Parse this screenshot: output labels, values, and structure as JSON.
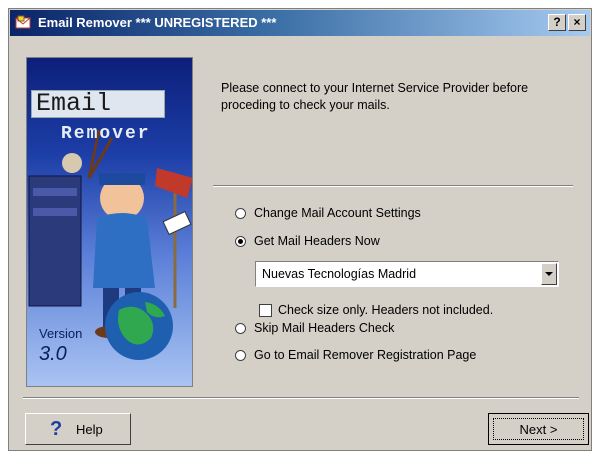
{
  "window": {
    "title": "Email Remover *** UNREGISTERED ***",
    "help_glyph": "?",
    "close_glyph": "×",
    "app_icon": "email-remover-app-icon"
  },
  "side_panel": {
    "logo_line1": "Email",
    "logo_line2": "Remover",
    "version_label": "Version",
    "version_number": "3.0"
  },
  "message": "Please connect to your Internet Service Provider before proceding to check your mails.",
  "options": [
    {
      "label": "Change Mail Account Settings",
      "checked": false
    },
    {
      "label": "Get Mail Headers Now",
      "checked": true
    },
    {
      "label": "Skip Mail Headers Check",
      "checked": false
    },
    {
      "label": "Go to Email Remover Registration Page",
      "checked": false
    }
  ],
  "account_dropdown": {
    "selected": "Nuevas Tecnologías Madrid"
  },
  "check_size": {
    "label": "Check size only. Headers not included.",
    "checked": false
  },
  "buttons": {
    "help_glyph": "?",
    "help_label": "Help",
    "next_label": "Next >"
  },
  "colors": {
    "title_bar_start": "#0a246a",
    "title_bar_end": "#a6caf0",
    "dialog_face": "#d4d0c8"
  }
}
